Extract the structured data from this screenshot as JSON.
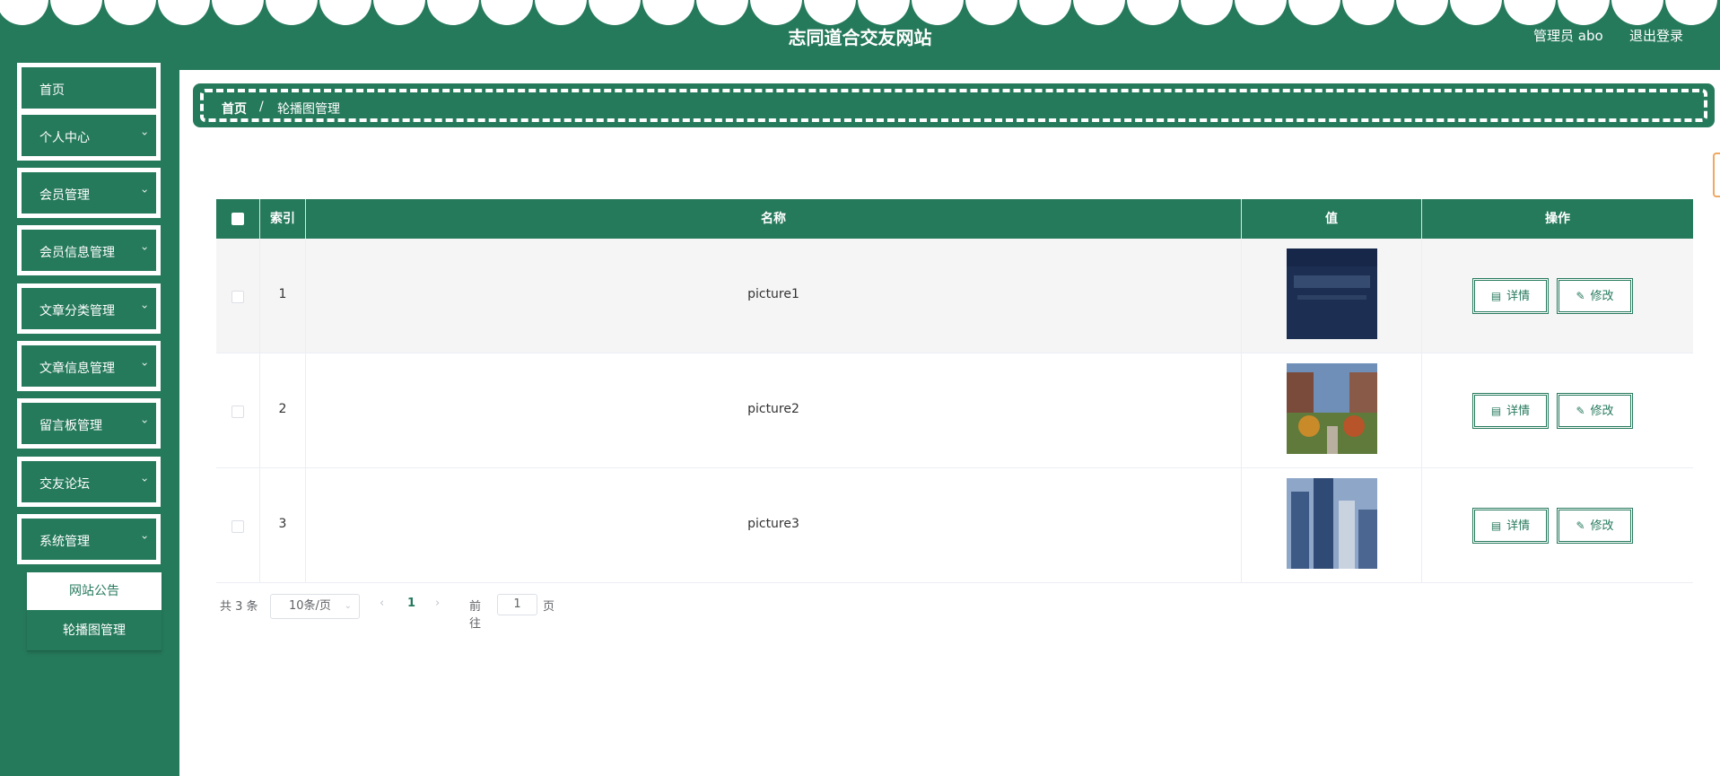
{
  "header": {
    "title": "志同道合交友网站",
    "admin_label": "管理员 abo",
    "logout_label": "退出登录",
    "bg_color": "#267a5c"
  },
  "sidebar": {
    "items": [
      {
        "label": "首页",
        "has_arrow": false
      },
      {
        "label": "个人中心",
        "has_arrow": true
      },
      {
        "label": "会员管理",
        "has_arrow": true
      },
      {
        "label": "会员信息管理",
        "has_arrow": true
      },
      {
        "label": "文章分类管理",
        "has_arrow": true
      },
      {
        "label": "文章信息管理",
        "has_arrow": true
      },
      {
        "label": "留言板管理",
        "has_arrow": true
      },
      {
        "label": "交友论坛",
        "has_arrow": true
      },
      {
        "label": "系统管理",
        "has_arrow": true
      }
    ],
    "submenu": [
      {
        "label": "网站公告"
      },
      {
        "label": "轮播图管理"
      }
    ]
  },
  "breadcrumb": {
    "home": "首页",
    "separator": "/",
    "current": "轮播图管理"
  },
  "table": {
    "columns": [
      "索引",
      "名称",
      "值",
      "操作"
    ],
    "rows": [
      {
        "index": "1",
        "name": "picture1",
        "thumb": "dark-navy-banner"
      },
      {
        "index": "2",
        "name": "picture2",
        "thumb": "campus-building-trees"
      },
      {
        "index": "3",
        "name": "picture3",
        "thumb": "city-buildings-blue"
      }
    ],
    "detail_label": "详情",
    "edit_label": "修改"
  },
  "pagination": {
    "total": "共 3 条",
    "page_size": "10条/页",
    "current_page": "1",
    "goto_label": "前往",
    "goto_value": "1",
    "page_suffix": "页"
  }
}
